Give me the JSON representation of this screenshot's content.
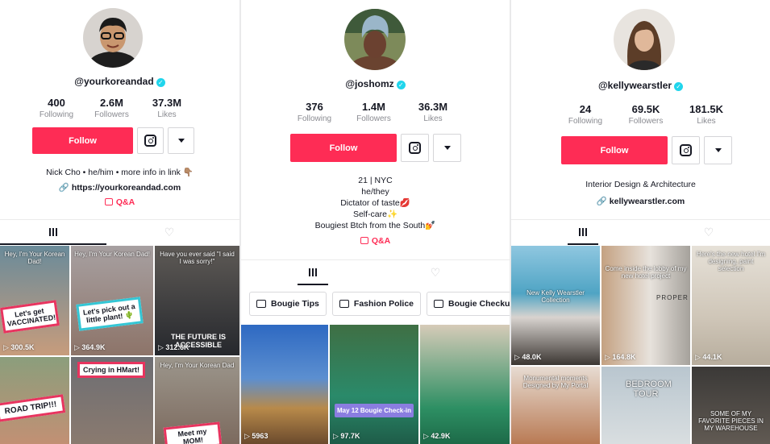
{
  "profiles": [
    {
      "handle": "@yourkoreandad",
      "stats": [
        {
          "num": "400",
          "label": "Following"
        },
        {
          "num": "2.6M",
          "label": "Followers"
        },
        {
          "num": "37.3M",
          "label": "Likes"
        }
      ],
      "follow_label": "Follow",
      "bio": "Nick Cho • he/him •  more info in link 👇🏽",
      "link": "https://yourkoreandad.com",
      "qa": "Q&A",
      "videos": [
        {
          "views": "300.5K",
          "caption": "Let's get VACCINATED!",
          "top": "Hey, I'm Your Korean Dad!"
        },
        {
          "views": "364.9K",
          "caption": "Let's pick out a little plant! 🌵",
          "top": "Hey, I'm Your Korean Dad!"
        },
        {
          "views": "312.6K",
          "caption": "THE FUTURE IS ACCESSIBLE",
          "top": "Have you ever said \"I said I was sorry!\""
        },
        {
          "views": "",
          "caption": "ROAD TRIP!!!",
          "top": ""
        },
        {
          "views": "",
          "caption": "Crying in HMart!",
          "top": ""
        },
        {
          "views": "",
          "caption": "Meet my MOM!",
          "top": "Hey, I'm Your Korean Dad"
        }
      ]
    },
    {
      "handle": "@joshomz",
      "stats": [
        {
          "num": "376",
          "label": "Following"
        },
        {
          "num": "1.4M",
          "label": "Followers"
        },
        {
          "num": "36.3M",
          "label": "Likes"
        }
      ],
      "follow_label": "Follow",
      "bio_lines": [
        "21 | NYC",
        "he/they",
        "Dictator of taste💋",
        "Self-care✨",
        "Bougiest Btch from the South💅"
      ],
      "qa": "Q&A",
      "playlists": [
        "Bougie Tips",
        "Fashion Police",
        "Bougie Checkups"
      ],
      "videos": [
        {
          "views": "5963",
          "caption": ""
        },
        {
          "views": "97.7K",
          "caption": "May 12 Bougie Check-in"
        },
        {
          "views": "42.9K",
          "caption": ""
        }
      ]
    },
    {
      "handle": "@kellywearstler",
      "stats": [
        {
          "num": "24",
          "label": "Following"
        },
        {
          "num": "69.5K",
          "label": "Followers"
        },
        {
          "num": "181.5K",
          "label": "Likes"
        }
      ],
      "follow_label": "Follow",
      "bio": "Interior Design & Architecture",
      "link": "kellywearstler.com",
      "videos": [
        {
          "views": "48.0K",
          "top": "New Kelly Wearstler Collection"
        },
        {
          "views": "164.8K",
          "top": "Come inside the lobby of my new hotel project",
          "sign": "PROPER"
        },
        {
          "views": "44.1K",
          "top": "Here's the new hotel I'm designing, paint selection"
        },
        {
          "views": "",
          "top": "Monumental moments Designed by My Portal"
        },
        {
          "views": "",
          "top": "BEDROOM TOUR"
        },
        {
          "views": "",
          "top": "SOME OF MY FAVORITE PIECES IN MY WAREHOUSE"
        }
      ]
    }
  ],
  "colors": {
    "accent": "#fe2c55",
    "verified": "#20d5ec"
  },
  "icons": [
    "verified-icon",
    "instagram-icon",
    "chevron-down-icon",
    "link-icon",
    "qa-icon",
    "grid-icon",
    "liked-heart-icon",
    "playlist-icon",
    "play-icon"
  ]
}
